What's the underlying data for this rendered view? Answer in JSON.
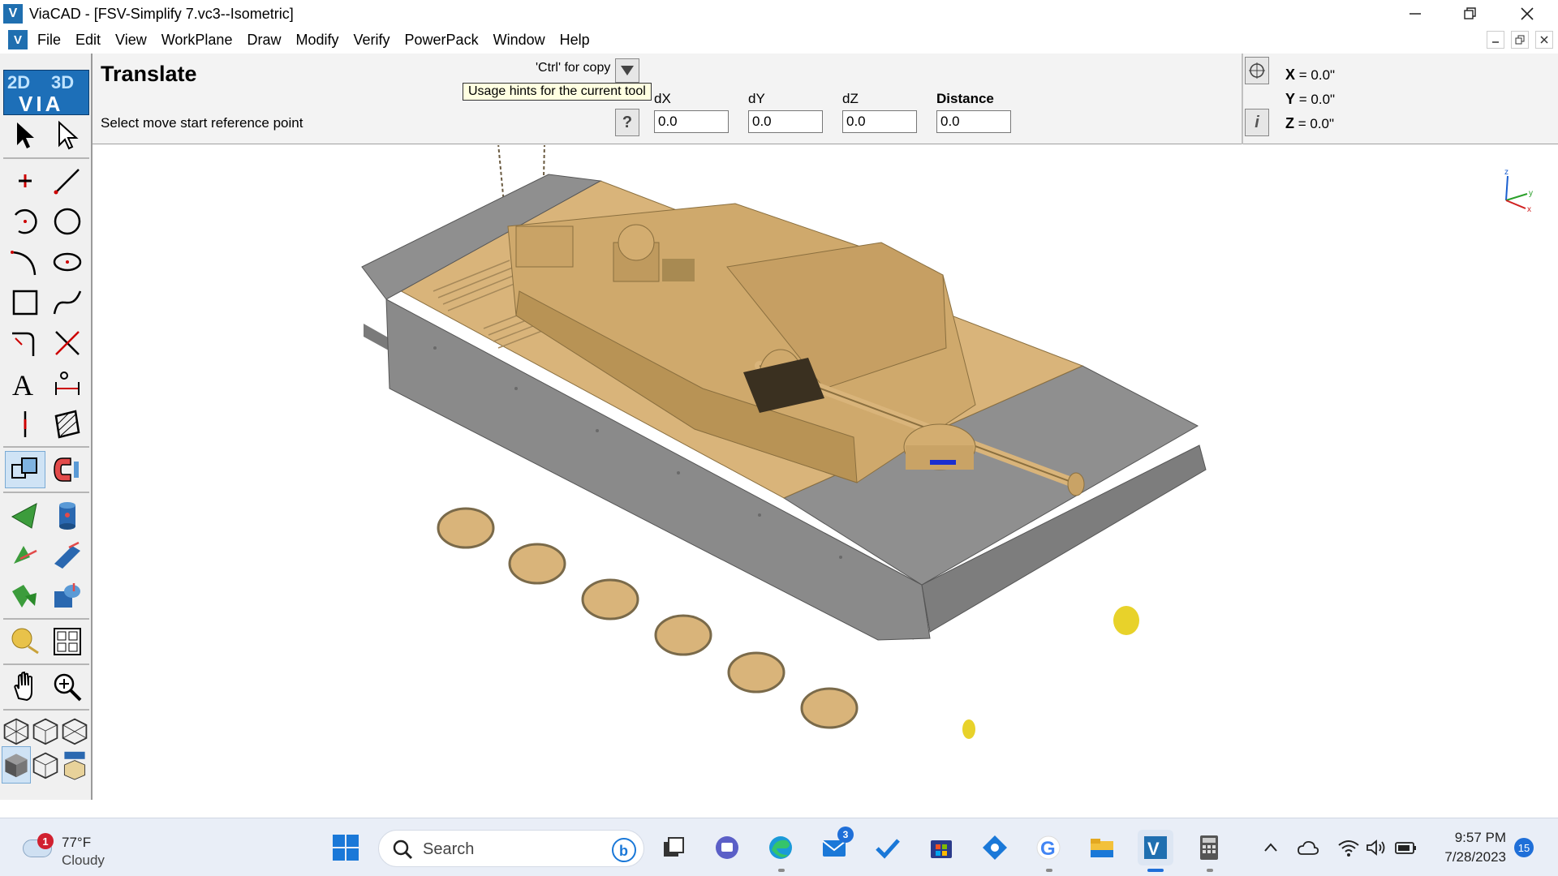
{
  "window": {
    "title": "ViaCAD - [FSV-Simplify 7.vc3--Isometric]",
    "app_icon": "V",
    "controls": [
      "minimize-icon",
      "restore-icon",
      "close-icon"
    ]
  },
  "menubar": {
    "items": [
      {
        "label": "File"
      },
      {
        "label": "Edit"
      },
      {
        "label": "View"
      },
      {
        "label": "WorkPlane"
      },
      {
        "label": "Draw"
      },
      {
        "label": "Modify"
      },
      {
        "label": "Verify"
      },
      {
        "label": "PowerPack"
      },
      {
        "label": "Window"
      },
      {
        "label": "Help"
      }
    ]
  },
  "command_panel": {
    "tool_name": "Translate",
    "prompt": "Select move start reference point",
    "ctrl_hint": "'Ctrl' for copy",
    "tooltip": "Usage hints for the current tool",
    "help_button": "?",
    "info_button": "i",
    "fields": [
      {
        "label": "dX",
        "value": "0.0"
      },
      {
        "label": "dY",
        "value": "0.0"
      },
      {
        "label": "dZ",
        "value": "0.0"
      },
      {
        "label": "Distance",
        "value": "0.0"
      }
    ],
    "coords": [
      {
        "axis": "X",
        "text": " = 0.0\""
      },
      {
        "axis": "Y",
        "text": " = 0.0\""
      },
      {
        "axis": "Z",
        "text": " = 0.0\""
      }
    ]
  },
  "toolbar": {
    "logo": {
      "left": "2D",
      "right": "3D",
      "bottom": "VIA"
    },
    "tools": [
      "select-arrow-icon",
      "select-subobject-icon",
      "point-icon",
      "line-icon",
      "arc-icon",
      "circle-icon",
      "curve-arc-icon",
      "ellipse-icon",
      "rectangle-icon",
      "spline-icon",
      "fillet-icon",
      "trim-icon",
      "text-icon",
      "dimension-icon",
      "centerline-icon",
      "hatch-icon",
      "translate-icon",
      "magnet-icon",
      "surface-icon",
      "cylinder-solid-icon",
      "sweep-icon",
      "extrude-icon",
      "loft-icon",
      "boolean-icon",
      "render-sphere-icon",
      "layout-icon",
      "pan-hand-icon",
      "zoom-icon",
      "view-iso-wire-icon",
      "view-hidden-icon",
      "view-outline-icon",
      "view-shaded-icon",
      "view-wire-box-icon",
      "view-info-icon"
    ]
  },
  "viewport": {
    "axes": {
      "x": "x",
      "y": "y",
      "z": "z"
    },
    "colors": {
      "hull": "#8a8a8a",
      "tan": "#d9b47a",
      "yellow": "#e8d22a",
      "blue": "#1a2fd0"
    }
  },
  "taskbar": {
    "weather": {
      "badge": "1",
      "temp": "77°F",
      "condition": "Cloudy"
    },
    "search_label": "Search",
    "mail_badge": "3",
    "time": "9:57 PM",
    "date": "7/28/2023",
    "notifications": "15"
  }
}
